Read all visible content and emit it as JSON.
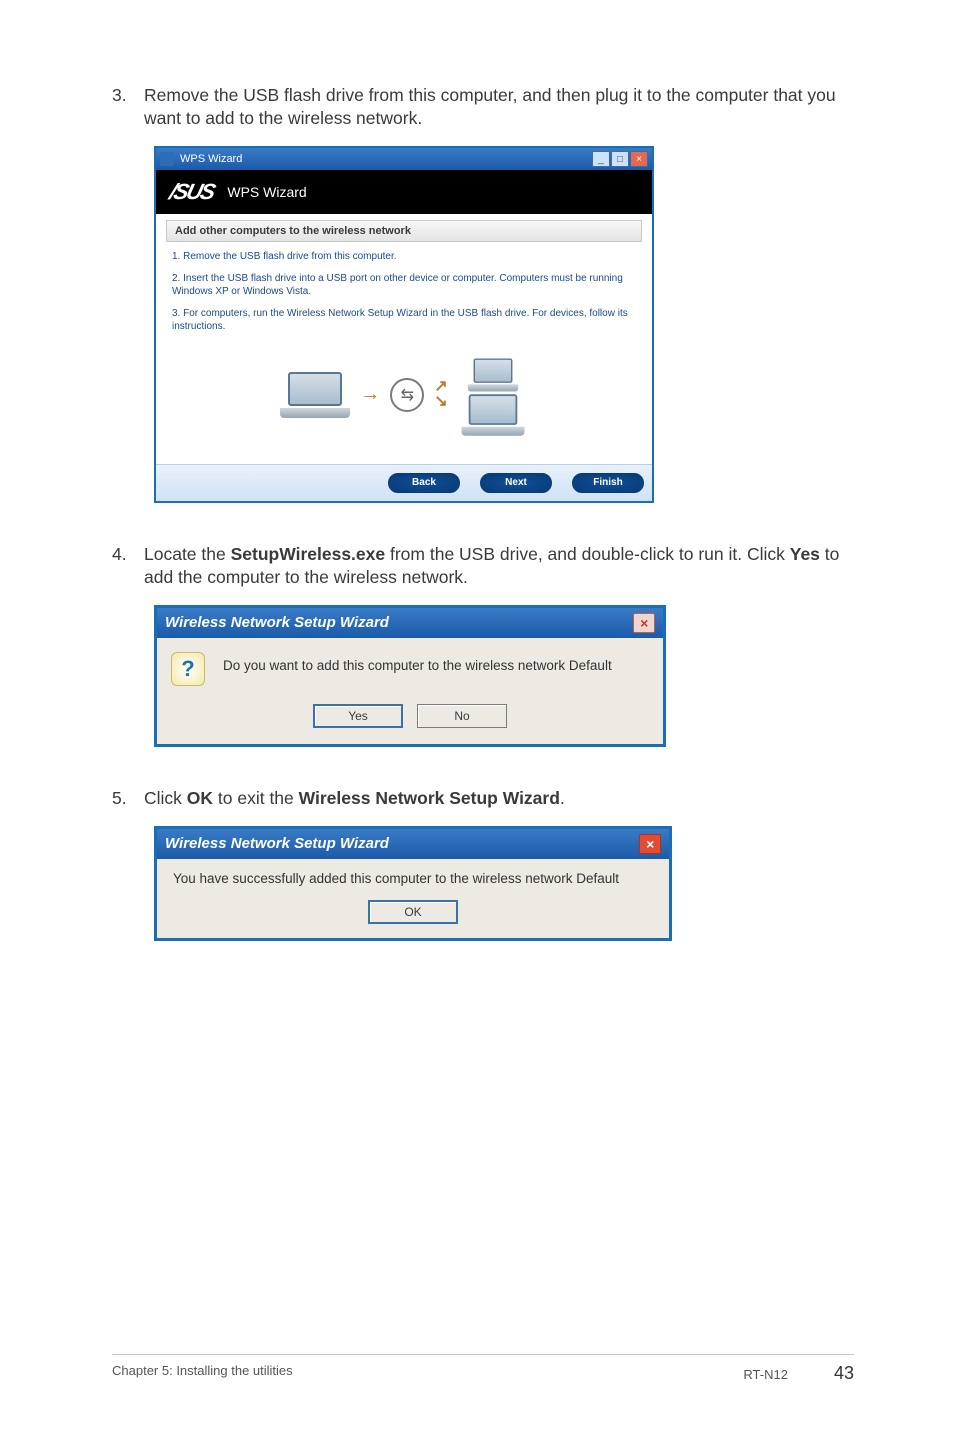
{
  "step3": {
    "num": "3.",
    "text": "Remove the USB flash drive from this computer, and then plug it to the computer that you want to add to the wireless network."
  },
  "wps": {
    "titlebar": "WPS Wizard",
    "header": "WPS Wizard",
    "section": "Add other computers to the wireless network",
    "line1": "1. Remove the USB flash drive from this computer.",
    "line2": "2. Insert the USB flash drive into a USB port on other device or computer. Computers must be running Windows XP or Windows Vista.",
    "line3": "3. For computers, run the Wireless Network Setup Wizard in the USB flash drive. For devices, follow its instructions.",
    "back": "Back",
    "next": "Next",
    "finish": "Finish",
    "min": "_",
    "max": "□",
    "close": "×"
  },
  "step4": {
    "num": "4.",
    "text_pre": "Locate the ",
    "bold1": "SetupWireless.exe",
    "text_mid": " from the USB drive, and double-click to run it. Click ",
    "bold2": "Yes",
    "text_post": " to add the computer to the wireless network."
  },
  "dlg2": {
    "title": "Wireless Network Setup Wizard",
    "msg": "Do you want to add this computer to the wireless network Default",
    "yes": "Yes",
    "no": "No",
    "close": "×"
  },
  "step5": {
    "num": "5.",
    "text_pre": "Click ",
    "bold1": "OK",
    "text_mid": " to exit the ",
    "bold2": "Wireless Network Setup Wizard",
    "text_post": "."
  },
  "dlg3": {
    "title": "Wireless Network Setup Wizard",
    "msg": "You have successfully added this computer to the wireless network Default",
    "ok": "OK",
    "close": "×"
  },
  "footer": {
    "left": "Chapter 5: Installing the utilities",
    "model": "RT-N12",
    "page": "43"
  },
  "logo": "/SUS"
}
